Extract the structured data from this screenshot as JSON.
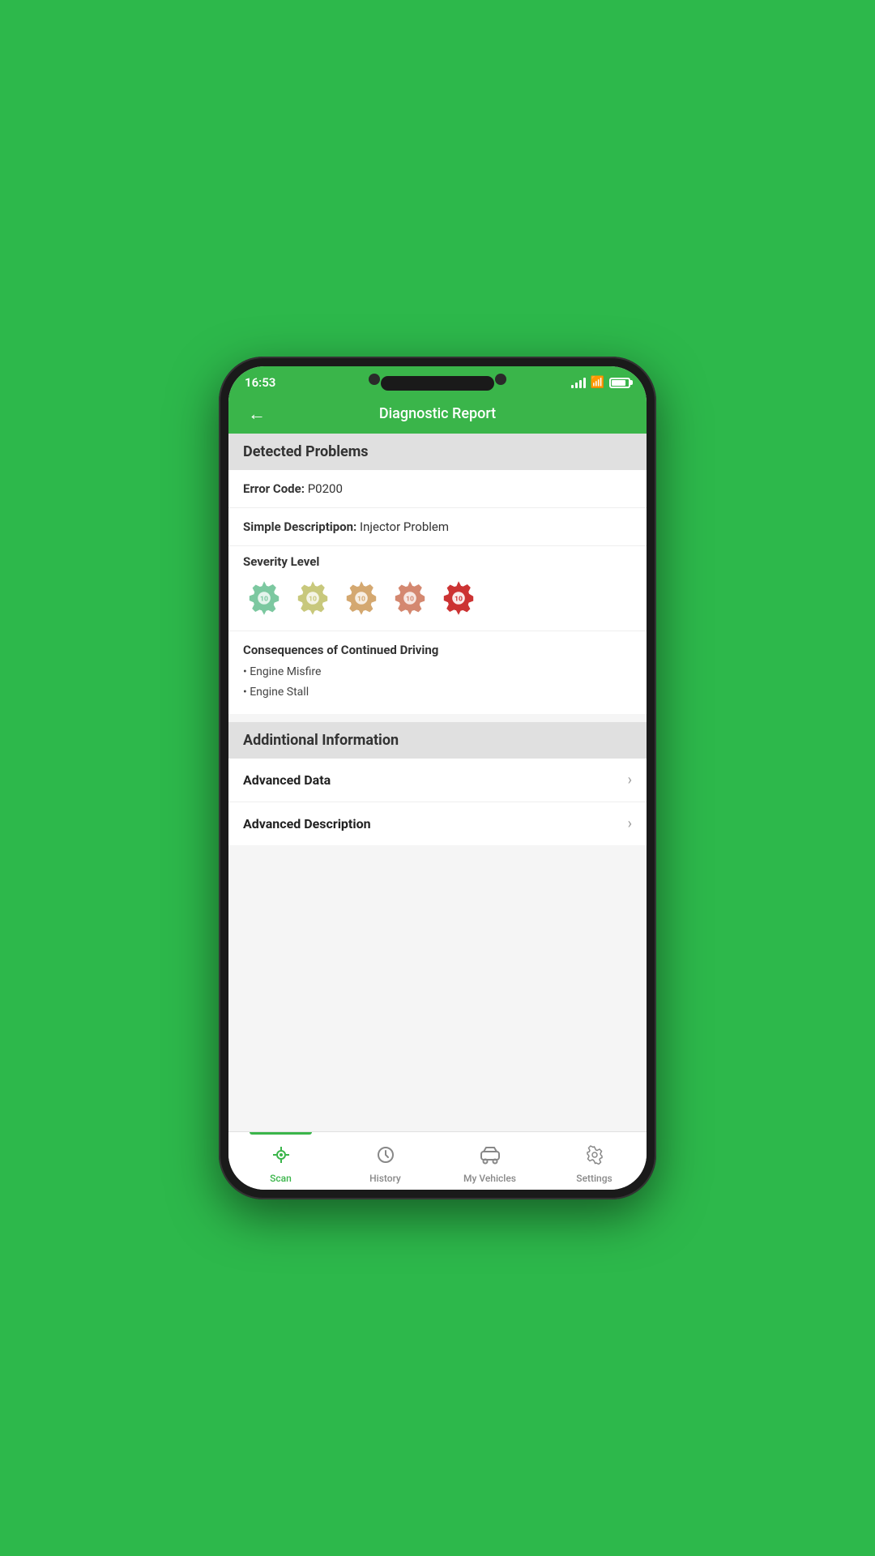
{
  "status_bar": {
    "time": "16:53"
  },
  "header": {
    "title": "Diagnostic Report",
    "back_label": "←"
  },
  "detected_problems": {
    "section_title": "Detected Problems",
    "error_code_label": "Error Code:",
    "error_code_value": "P0200",
    "description_label": "Simple Descriptipon:",
    "description_value": "Injector Problem",
    "severity_label": "Severity Level",
    "severity_levels": [
      1,
      2,
      3,
      4,
      5
    ],
    "consequences_title": "Consequences of Continued Driving",
    "consequences": [
      "Engine Misfire",
      "Engine Stall"
    ]
  },
  "additional_info": {
    "section_title": "Addintional Information",
    "items": [
      {
        "label": "Advanced Data"
      },
      {
        "label": "Advanced Description"
      }
    ]
  },
  "bottom_nav": {
    "items": [
      {
        "id": "scan",
        "label": "Scan",
        "active": true
      },
      {
        "id": "history",
        "label": "History",
        "active": false
      },
      {
        "id": "my-vehicles",
        "label": "My Vehicles",
        "active": false
      },
      {
        "id": "settings",
        "label": "Settings",
        "active": false
      }
    ]
  }
}
